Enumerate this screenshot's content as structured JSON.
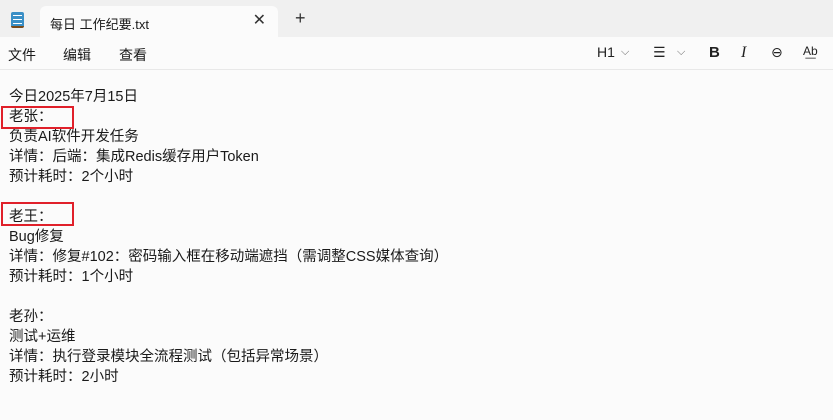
{
  "tab": {
    "title": "每日 工作纪要.txt",
    "close": "✕",
    "new": "+"
  },
  "menu": [
    "文件",
    "编辑",
    "查看"
  ],
  "toolbar": {
    "heading": "H1",
    "heading_chevron": "⌵",
    "list": "☰",
    "list_chevron": "⌵",
    "bold": "B",
    "italic": "I",
    "link": "⊖",
    "spell": "A͟b"
  },
  "lines": [
    "今日2025年7月15日",
    "老张：",
    "负责AI软件开发任务",
    "详情：后端：集成Redis缓存用户Token",
    "预计耗时：2个小时",
    "",
    "老王：",
    "Bug修复",
    "详情：修复#102：密码输入框在移动端遮挡（需调整CSS媒体查询）",
    "预计耗时：1个小时",
    "",
    "老孙：",
    "测试+运维",
    "详情：执行登录模块全流程测试（包括异常场景）",
    "预计耗时：2小时"
  ],
  "colors": {
    "highlight": "#e0202a"
  }
}
